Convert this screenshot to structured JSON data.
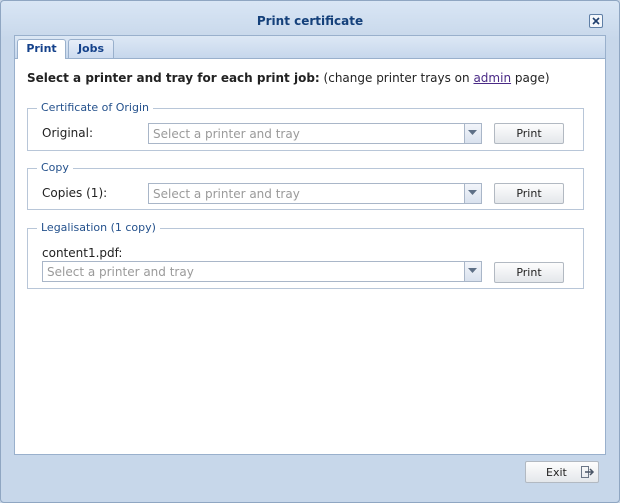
{
  "window": {
    "title": "Print certificate"
  },
  "tabs": [
    {
      "label": "Print",
      "active": true
    },
    {
      "label": "Jobs",
      "active": false
    }
  ],
  "heading": {
    "bold": "Select a printer and tray for each print job:",
    "pre_link": " (change printer trays on ",
    "link": "admin",
    "post_link": " page)"
  },
  "sections": [
    {
      "legend": "Certificate of Origin",
      "label": "Original:",
      "placeholder": "Select a printer and tray",
      "button": "Print"
    },
    {
      "legend": "Copy",
      "label": "Copies (1):",
      "placeholder": "Select a printer and tray",
      "button": "Print"
    },
    {
      "legend": "Legalisation (1 copy)",
      "label": "content1.pdf:",
      "placeholder": "Select a printer and tray",
      "button": "Print"
    }
  ],
  "footer": {
    "exit_label": "Exit"
  },
  "icons": {
    "close": "close-icon",
    "dropdown": "chevron-down-icon",
    "exit": "exit-arrow-icon"
  }
}
